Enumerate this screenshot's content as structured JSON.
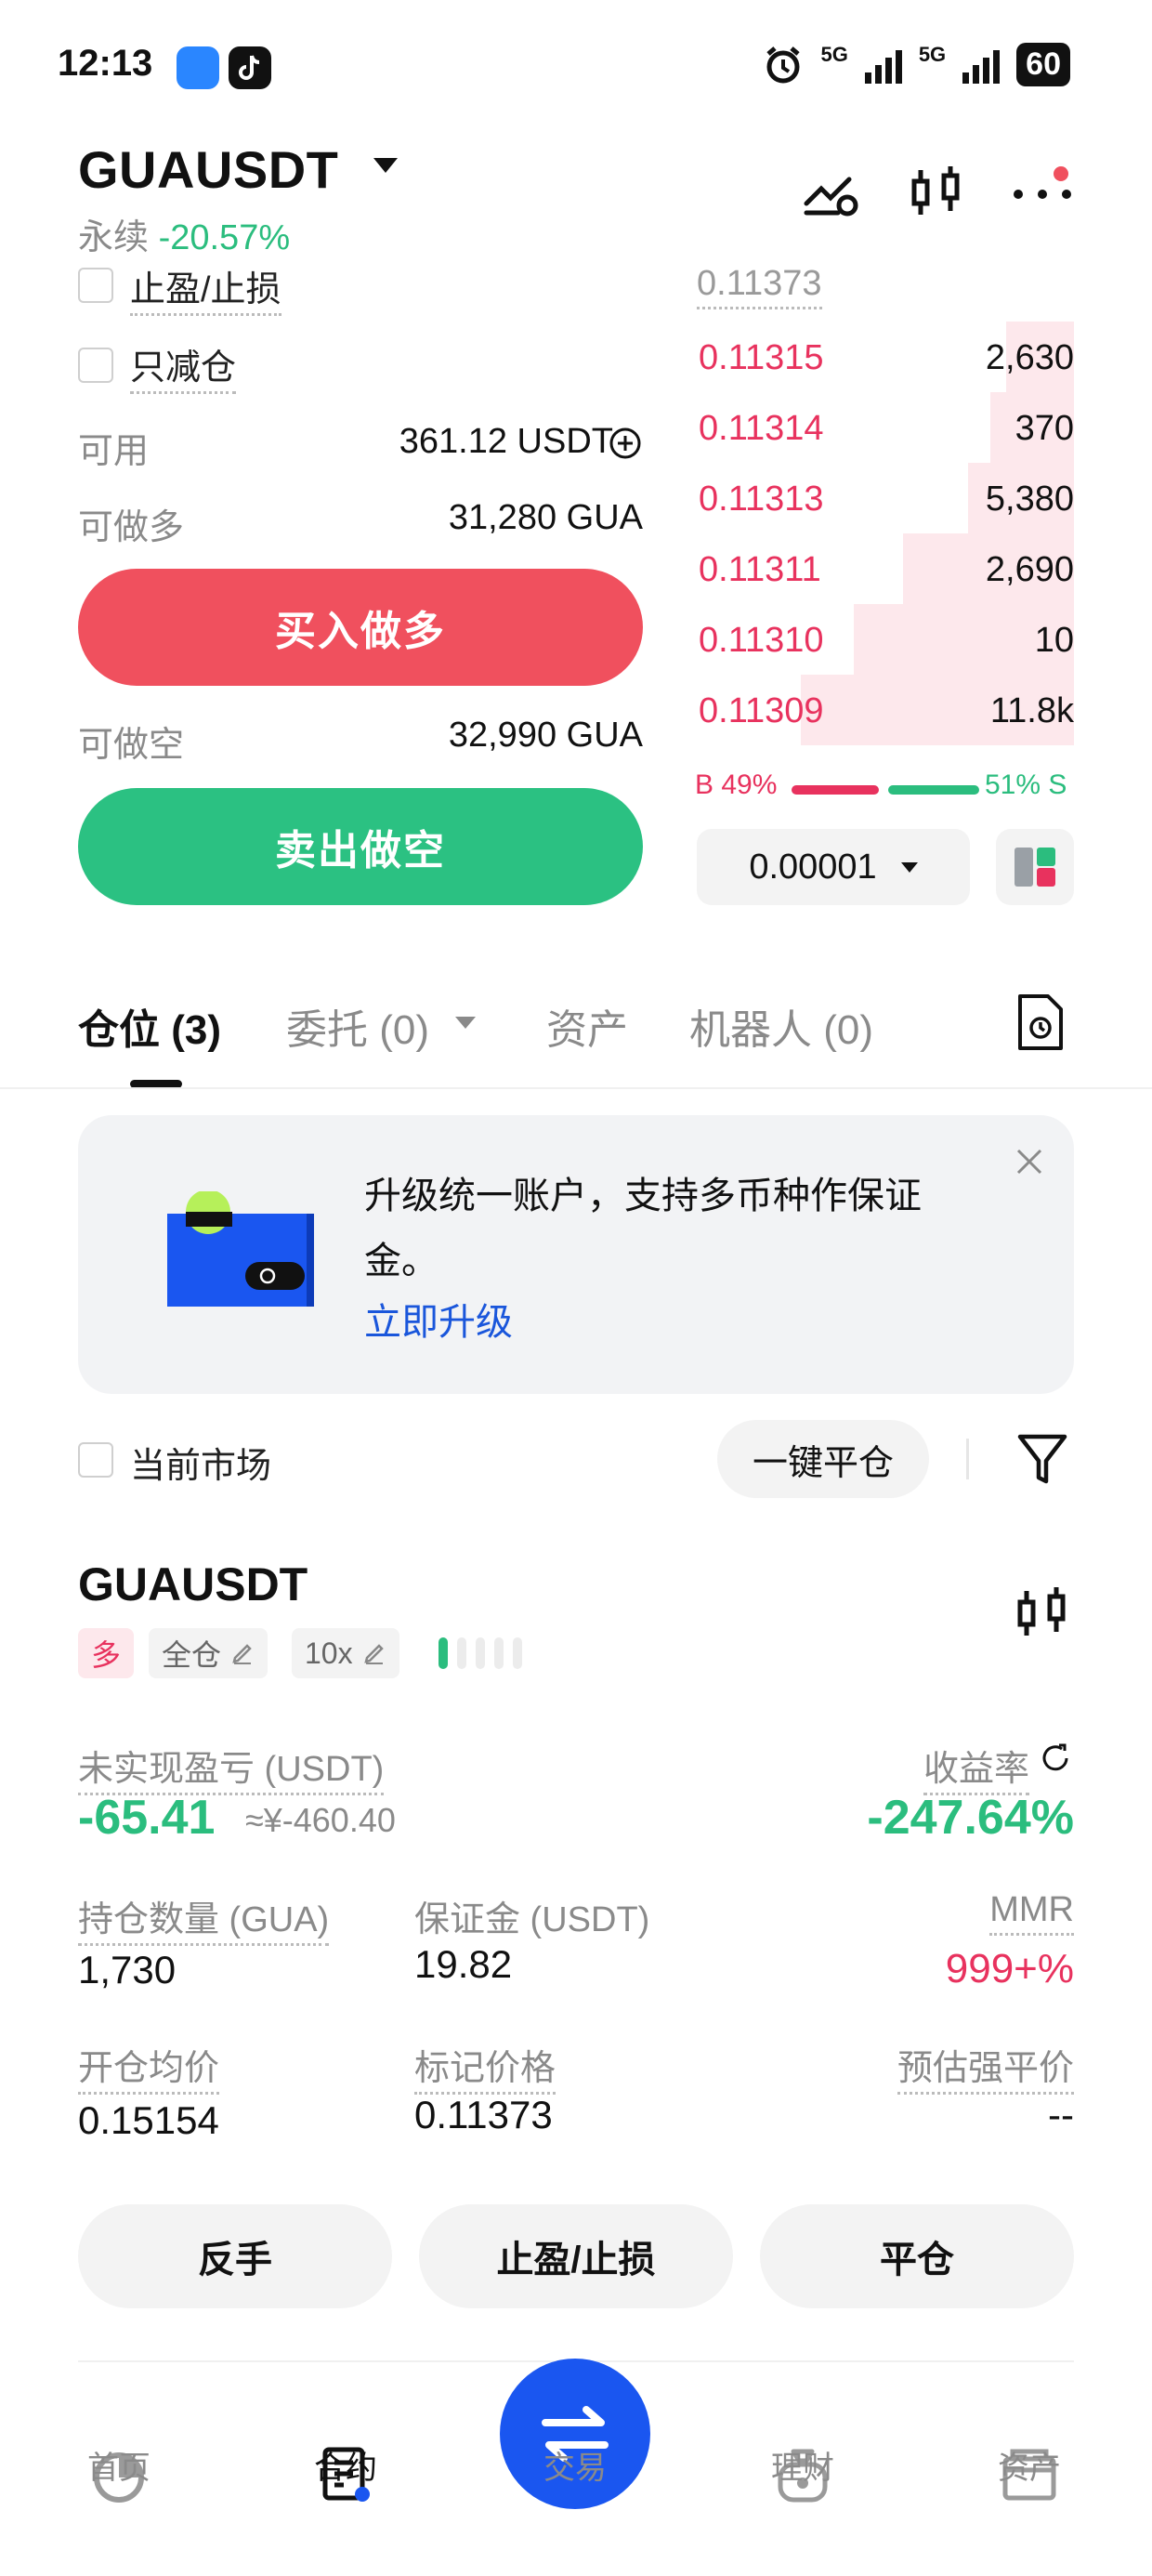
{
  "status_bar": {
    "time": "12:13",
    "network1": "5G",
    "network2": "5G",
    "battery": "60"
  },
  "header": {
    "pair": "GUAUSDT",
    "perp_label": "永续",
    "change": "-20.57%"
  },
  "form": {
    "tpsl_label": "止盈/止损",
    "reduce_only_label": "只减仓",
    "available_label": "可用",
    "available_value": "361.12 USDT",
    "can_long_label": "可做多",
    "can_long_value": "31,280 GUA",
    "buy_long_label": "买入做多",
    "can_short_label": "可做空",
    "can_short_value": "32,990 GUA",
    "sell_short_label": "卖出做空"
  },
  "order_book": {
    "last_price": "0.11373",
    "asks": [
      {
        "price": "0.11315",
        "qty": "2,630",
        "depth": 0.18
      },
      {
        "price": "0.11314",
        "qty": "370",
        "depth": 0.22
      },
      {
        "price": "0.11313",
        "qty": "5,380",
        "depth": 0.28
      },
      {
        "price": "0.11311",
        "qty": "2,690",
        "depth": 0.45
      },
      {
        "price": "0.11310",
        "qty": "10",
        "depth": 0.58
      },
      {
        "price": "0.11309",
        "qty": "11.8k",
        "depth": 0.72
      }
    ],
    "buy_ratio": "B 49%",
    "sell_ratio": "51% S",
    "tick_size": "0.00001"
  },
  "tabs": [
    {
      "label": "仓位 (3)"
    },
    {
      "label": "委托 (0)"
    },
    {
      "label": "资产"
    },
    {
      "label": "机器人 (0)"
    }
  ],
  "banner": {
    "text": "升级统一账户，支持多币种作保证金。",
    "link": "立即升级"
  },
  "filter": {
    "current_market_label": "当前市场",
    "close_all_label": "一键平仓"
  },
  "position": {
    "pair": "GUAUSDT",
    "side": "多",
    "margin_mode": "全仓",
    "leverage": "10x",
    "unrealized_pnl_label": "未实现盈亏 (USDT)",
    "unrealized_pnl": "-65.41",
    "unrealized_pnl_cny": "≈¥-460.40",
    "roe_label": "收益率",
    "roe": "-247.64%",
    "size_label": "持仓数量 (GUA)",
    "size": "1,730",
    "margin_label": "保证金 (USDT)",
    "margin": "19.82",
    "mmr_label": "MMR",
    "mmr": "999+%",
    "entry_label": "开仓均价",
    "entry": "0.15154",
    "mark_label": "标记价格",
    "mark": "0.11373",
    "liq_label": "预估强平价",
    "liq": "--",
    "buttons": {
      "reverse": "反手",
      "tpsl": "止盈/止损",
      "close": "平仓"
    }
  },
  "bottom_nav": [
    {
      "label": "首页"
    },
    {
      "label": "合约"
    },
    {
      "label": "交易"
    },
    {
      "label": "理财"
    },
    {
      "label": "资产"
    }
  ],
  "colors": {
    "green": "#2bbd7e",
    "red": "#e8325e",
    "buy_button": "#f0505e",
    "sell_button": "#2bc182",
    "accent_blue": "#1a56f0"
  }
}
